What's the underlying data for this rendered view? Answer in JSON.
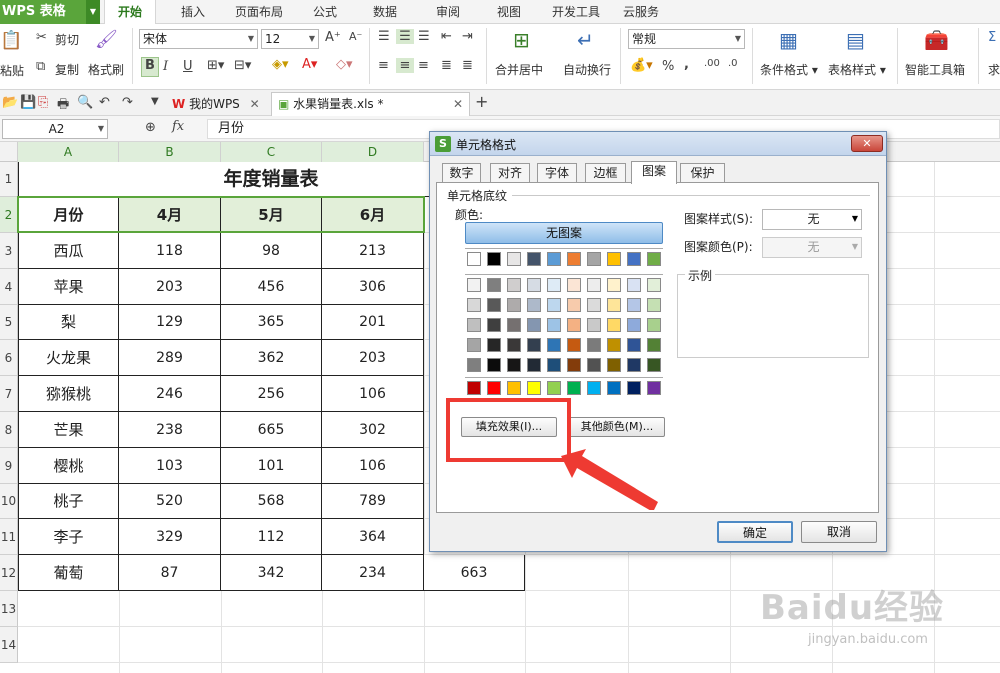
{
  "app": {
    "title": "WPS 表格"
  },
  "menu": [
    "开始",
    "插入",
    "页面布局",
    "公式",
    "数据",
    "审阅",
    "视图",
    "开发工具",
    "云服务"
  ],
  "ribbon": {
    "paste": "粘贴",
    "cut": "剪切",
    "copy": "复制",
    "format_painter": "格式刷",
    "font_name": "宋体",
    "font_size": "12",
    "bold": "B",
    "italic": "I",
    "underline": "U",
    "merge_center": "合并居中",
    "wrap_text": "自动换行",
    "number_format": "常规",
    "percent": "%",
    "comma": ",",
    "cond_format": "条件格式",
    "table_style": "表格样式",
    "smart_tools": "智能工具箱",
    "more": "求"
  },
  "doc_tabs": [
    {
      "label": "我的WPS"
    },
    {
      "label": "水果销量表.xls *"
    }
  ],
  "formula_bar": {
    "cell_ref": "A2",
    "fx": "fx",
    "value": "月份"
  },
  "columns": [
    "A",
    "B",
    "C",
    "D"
  ],
  "rows": [
    "1",
    "2",
    "3",
    "4",
    "5",
    "6",
    "7",
    "8",
    "9",
    "10",
    "11",
    "12",
    "13",
    "14"
  ],
  "sheet": {
    "title": "年度销量表",
    "headers": [
      "月份",
      "4月",
      "5月",
      "6月"
    ],
    "data": [
      [
        "西瓜",
        "118",
        "98",
        "213"
      ],
      [
        "苹果",
        "203",
        "456",
        "306"
      ],
      [
        "梨",
        "129",
        "365",
        "201"
      ],
      [
        "火龙果",
        "289",
        "362",
        "203"
      ],
      [
        "猕猴桃",
        "246",
        "256",
        "106"
      ],
      [
        "芒果",
        "238",
        "665",
        "302"
      ],
      [
        "樱桃",
        "103",
        "101",
        "106"
      ],
      [
        "桃子",
        "520",
        "568",
        "789"
      ],
      [
        "李子",
        "329",
        "112",
        "364"
      ],
      [
        "葡萄",
        "87",
        "342",
        "234",
        "663"
      ]
    ]
  },
  "dialog": {
    "title": "单元格格式",
    "tabs": [
      "数字",
      "对齐",
      "字体",
      "边框",
      "图案",
      "保护"
    ],
    "active_tab": "图案",
    "section": "单元格底纹",
    "color_label": "颜色:",
    "no_pattern": "无图案",
    "pattern_style_label": "图案样式(S):",
    "pattern_style_value": "无",
    "pattern_color_label": "图案颜色(P):",
    "pattern_color_value": "无",
    "sample_label": "示例",
    "fill_effects": "填充效果(I)...",
    "more_colors": "其他颜色(M)...",
    "ok": "确定",
    "cancel": "取消"
  },
  "palette": [
    [
      "#ffffff",
      "#000000",
      "#e7e6e6",
      "#44546a",
      "#5b9bd5",
      "#ed7d31",
      "#a5a5a5",
      "#ffc000",
      "#4472c4",
      "#70ad47"
    ],
    [
      "#f2f2f2",
      "#7f7f7f",
      "#d0cece",
      "#d6dce4",
      "#deebf6",
      "#fbe5d5",
      "#ededed",
      "#fff2cc",
      "#d9e2f3",
      "#e2efd9"
    ],
    [
      "#d8d8d8",
      "#595959",
      "#aeabab",
      "#adb9ca",
      "#bdd7ee",
      "#f7cbac",
      "#dbdbdb",
      "#fee599",
      "#b4c6e7",
      "#c5e0b3"
    ],
    [
      "#bfbfbf",
      "#3f3f3f",
      "#757070",
      "#8496b0",
      "#9dc3e6",
      "#f4b183",
      "#c9c9c9",
      "#ffd965",
      "#8eaadb",
      "#a8d08d"
    ],
    [
      "#a5a5a5",
      "#262626",
      "#3a3838",
      "#333f4f",
      "#2e75b5",
      "#c55a11",
      "#7b7b7b",
      "#bf9000",
      "#2f5496",
      "#538135"
    ],
    [
      "#7f7f7f",
      "#0c0c0c",
      "#171616",
      "#222a35",
      "#1e4e79",
      "#833c0b",
      "#525252",
      "#7f6000",
      "#1f3864",
      "#375623"
    ],
    [
      "#c00000",
      "#ff0000",
      "#ffc000",
      "#ffff00",
      "#92d050",
      "#00b050",
      "#00b0f0",
      "#0070c0",
      "#002060",
      "#7030a0"
    ]
  ],
  "watermark": {
    "brand": "Baidu经验",
    "url": "jingyan.baidu.com"
  },
  "colors": {
    "accent": "#5aa53b",
    "highlight": "#ee3a32",
    "header_fill": "#e2efd9"
  }
}
